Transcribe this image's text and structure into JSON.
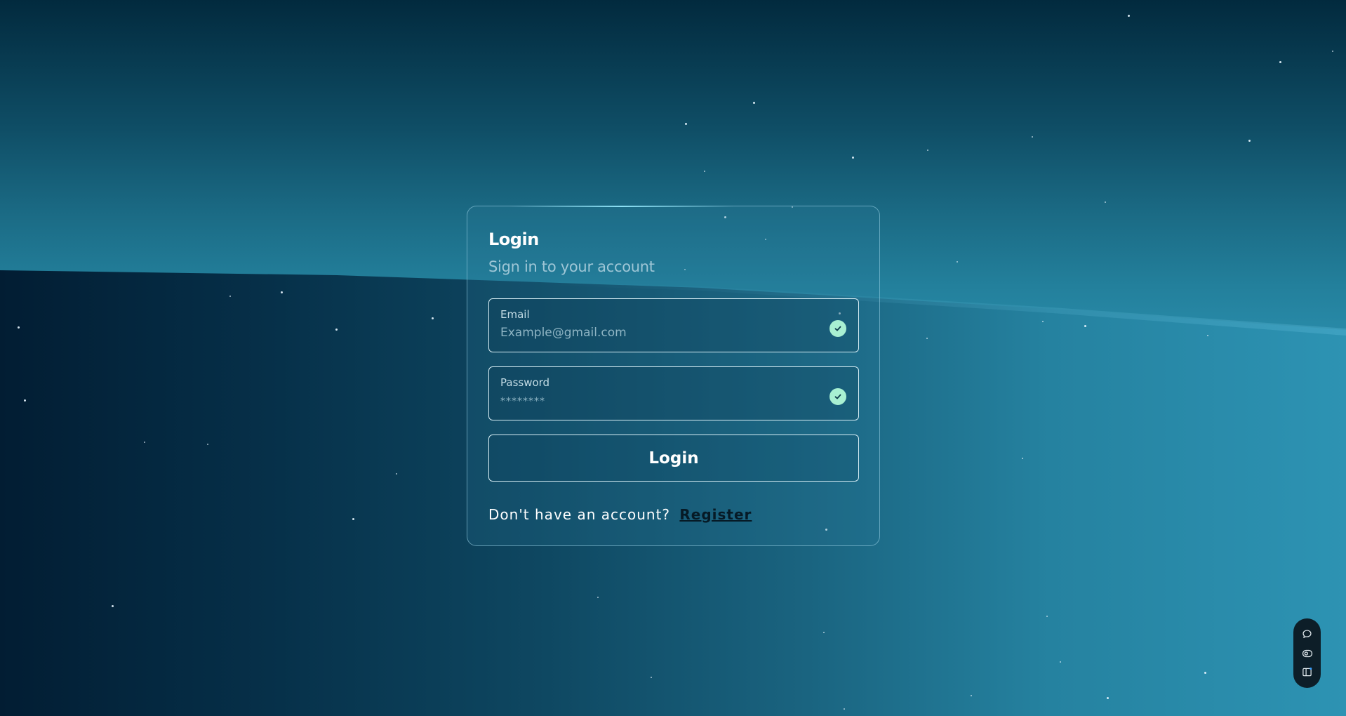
{
  "login": {
    "title": "Login",
    "subtitle": "Sign in to your account",
    "email": {
      "label": "Email",
      "placeholder": "Example@gmail.com",
      "value": "",
      "status_icon": "check-circle-icon"
    },
    "password": {
      "label": "Password",
      "placeholder": "********",
      "value": "",
      "status_icon": "check-circle-icon"
    },
    "submit_label": "Login",
    "register_prompt": "Don't have an account?",
    "register_link": "Register"
  },
  "dock": {
    "items": [
      {
        "icon": "chat-bubble-icon"
      },
      {
        "icon": "eye-toggle-icon"
      },
      {
        "icon": "sidebar-panel-icon"
      }
    ]
  },
  "colors": {
    "check_badge": "#a8f0d2",
    "card_border": "#a0d7eb",
    "register_link": "#061a26"
  }
}
